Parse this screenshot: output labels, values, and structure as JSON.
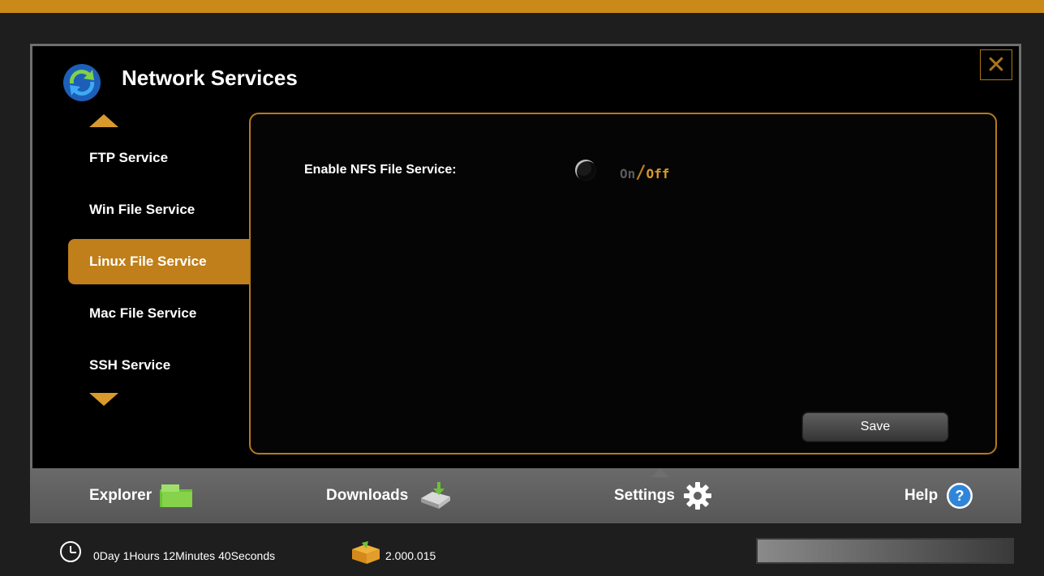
{
  "window": {
    "title": "Network Services",
    "close_icon": "close-icon"
  },
  "sidebar": {
    "items": [
      {
        "label": "FTP Service",
        "active": false
      },
      {
        "label": "Win File Service",
        "active": false
      },
      {
        "label": "Linux File Service",
        "active": true
      },
      {
        "label": "Mac File Service",
        "active": false
      },
      {
        "label": "SSH Service",
        "active": false
      }
    ]
  },
  "content": {
    "field_label": "Enable NFS File Service:",
    "toggle_on": "On",
    "toggle_sep": "/",
    "toggle_off": "Off",
    "selected": "Off",
    "save_label": "Save"
  },
  "tabs": [
    {
      "label": "Explorer",
      "icon": "folder-icon"
    },
    {
      "label": "Downloads",
      "icon": "download-drive-icon"
    },
    {
      "label": "Settings",
      "icon": "gear-icon",
      "active": true
    },
    {
      "label": "Help",
      "icon": "help-icon"
    }
  ],
  "status": {
    "uptime": "0Day 1Hours 12Minutes 40Seconds",
    "version": "2.000.015",
    "progress": 1.0
  },
  "colors": {
    "accent": "#c07f1a",
    "border": "#b67a1c",
    "panel_bg": "#000000",
    "tabbar_bg": "#616161"
  }
}
